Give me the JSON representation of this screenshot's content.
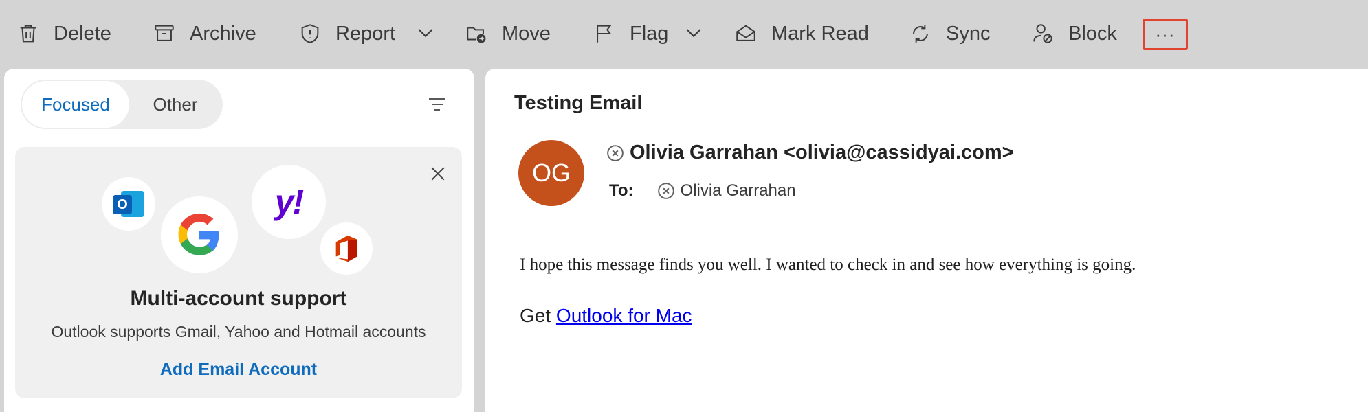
{
  "toolbar": {
    "delete": "Delete",
    "archive": "Archive",
    "report": "Report",
    "move": "Move",
    "flag": "Flag",
    "mark_read": "Mark Read",
    "sync": "Sync",
    "block": "Block",
    "more": "···"
  },
  "tabs": {
    "focused": "Focused",
    "other": "Other"
  },
  "promo": {
    "title": "Multi-account support",
    "subtitle": "Outlook supports Gmail, Yahoo and Hotmail accounts",
    "link": "Add Email Account",
    "yahoo_glyph": "y!",
    "google_glyph": "G",
    "outlook_glyph": "O"
  },
  "email": {
    "subject": "Testing Email",
    "avatar_initials": "OG",
    "from": "Olivia Garrahan <olivia@cassidyai.com>",
    "to_label": "To:",
    "to": "Olivia Garrahan",
    "body": "I hope this message finds you well. I wanted to check in and see how everything is going.",
    "sig_prefix": "Get ",
    "sig_link": "Outlook for Mac"
  },
  "colors": {
    "accent": "#0f6cbd",
    "avatar_bg": "#c4501c",
    "highlight_border": "#e0432e",
    "link": "#0000ee"
  }
}
